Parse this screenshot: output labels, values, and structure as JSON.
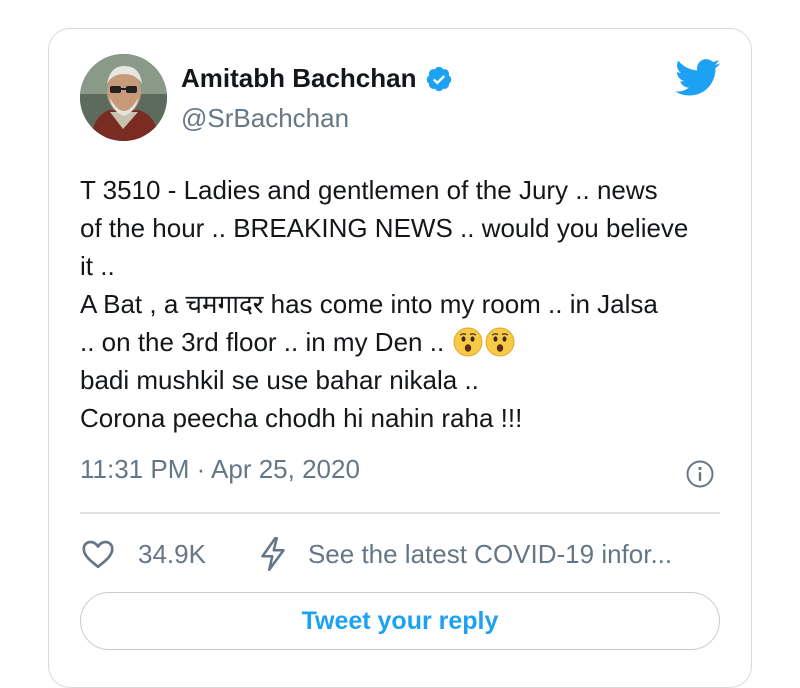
{
  "author": {
    "display_name": "Amitabh Bachchan",
    "handle": "@SrBachchan",
    "verified_icon": "verified-badge-icon",
    "avatar": "avatar-photo"
  },
  "brand": {
    "logo_icon": "twitter-bird-icon",
    "accent_color": "#1da1f2"
  },
  "tweet": {
    "lines": [
      "T 3510 - Ladies and gentlemen of the Jury .. news",
      "of the hour .. BREAKING NEWS .. would you believe",
      "it ..",
      "A Bat , a चमगादर has come into my room .. in Jalsa",
      ".. on the 3rd floor .. in my Den ..",
      "badi mushkil se use bahar nikala ..",
      "Corona peecha chodh hi nahin raha  !!!"
    ],
    "emojis": [
      "hushed-face-emoji",
      "hushed-face-emoji"
    ]
  },
  "meta": {
    "timestamp": "11:31 PM · Apr 25, 2020",
    "info_icon": "info-icon"
  },
  "actions": {
    "like_icon": "heart-icon",
    "like_count": "34.9K",
    "covid_icon": "lightning-bolt-icon",
    "covid_text": "See the latest COVID-19 infor..."
  },
  "reply": {
    "label": "Tweet your reply"
  }
}
